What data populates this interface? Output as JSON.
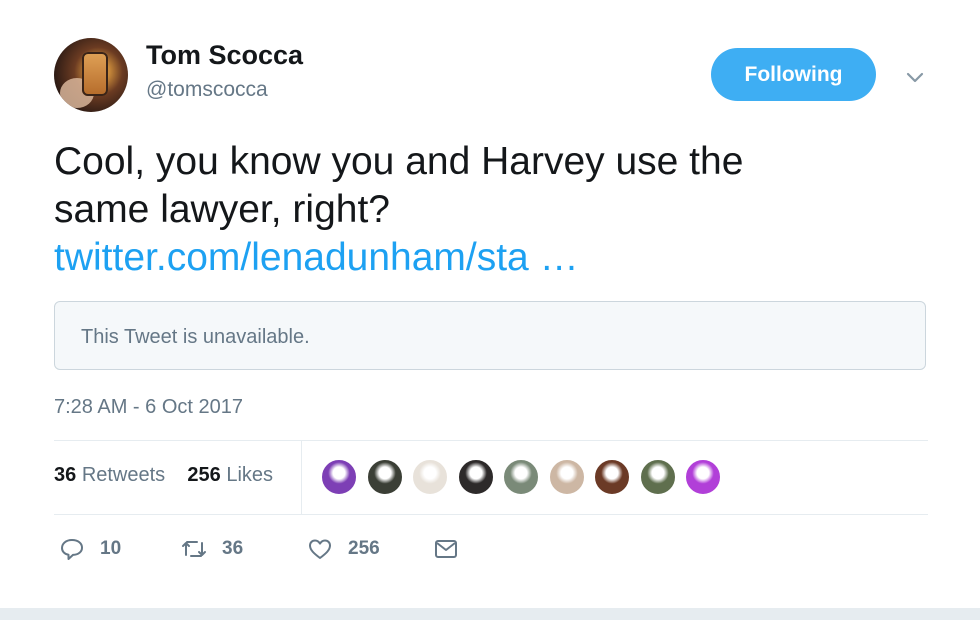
{
  "author": {
    "name": "Tom Scocca",
    "handle": "@tomscocca",
    "avatar_icon": "profile-photo"
  },
  "follow_button": {
    "label": "Following",
    "color": "#1da1f2"
  },
  "menu_icon": "chevron-down-icon",
  "tweet": {
    "text_lines": [
      "Cool, you know you and Harvey use the",
      "same lawyer, right?"
    ],
    "link_text": "twitter.com/lenadunham/sta …",
    "link_color": "#1da1f2"
  },
  "quoted_tweet": {
    "message": "This Tweet is unavailable."
  },
  "timestamp": "7:28 AM - 6 Oct 2017",
  "stats": {
    "retweets_count": "36",
    "retweets_label": "Retweets",
    "likes_count": "256",
    "likes_label": "Likes"
  },
  "likers": [
    {
      "bg": "#7d3fb5"
    },
    {
      "bg": "#3b3f36"
    },
    {
      "bg": "#e8e2da"
    },
    {
      "bg": "#2d2a2a"
    },
    {
      "bg": "#7a8a78"
    },
    {
      "bg": "#cdb7a4"
    },
    {
      "bg": "#6b3a26"
    },
    {
      "bg": "#5f6f4e"
    },
    {
      "bg": "#b13fd8"
    }
  ],
  "actions": {
    "reply": {
      "icon": "reply-icon",
      "count": "10"
    },
    "retweet": {
      "icon": "retweet-icon",
      "count": "36"
    },
    "like": {
      "icon": "heart-icon",
      "count": "256"
    },
    "dm": {
      "icon": "envelope-icon"
    }
  },
  "colors": {
    "secondary_text": "#657786",
    "border": "#e6ecf0",
    "quote_bg": "#f5f8fa"
  }
}
